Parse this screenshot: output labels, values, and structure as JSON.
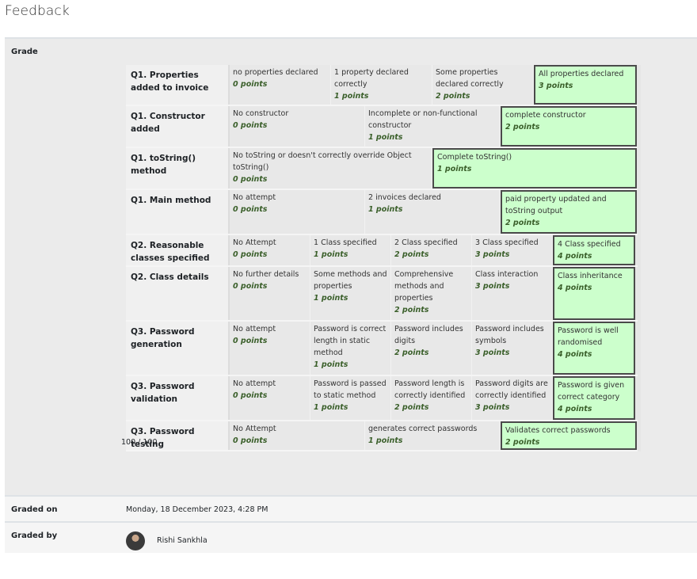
{
  "page": {
    "title": "Feedback"
  },
  "grade_label": "Grade",
  "rubric": [
    {
      "title": "Q1. Properties added to invoice",
      "levels": [
        {
          "desc": "no properties declared",
          "points": "0 points",
          "w": 128
        },
        {
          "desc": "1 property declared correctly",
          "points": "1 points",
          "w": 128
        },
        {
          "desc": "Some properties declared correctly",
          "points": "2 points",
          "w": 128
        },
        {
          "desc": "All properties declared",
          "points": "3 points",
          "w": 130,
          "selected": true
        }
      ],
      "h": 52
    },
    {
      "title": "Q1. Constructor added",
      "levels": [
        {
          "desc": "No constructor",
          "points": "0 points",
          "w": 171
        },
        {
          "desc": "Incomplete or non-functional constructor",
          "points": "1 points",
          "w": 171
        },
        {
          "desc": "complete constructor",
          "points": "2 points",
          "w": 172,
          "selected": true
        }
      ],
      "h": 53
    },
    {
      "title": "Q1. toString() method",
      "levels": [
        {
          "desc": "No toString or doesn't correctly override Object toString()",
          "points": "0 points",
          "w": 256
        },
        {
          "desc": "Complete toString()",
          "points": "1 points",
          "w": 258,
          "selected": true
        }
      ],
      "h": 53
    },
    {
      "title": "Q1. Main method",
      "levels": [
        {
          "desc": "No attempt",
          "points": "0 points",
          "w": 171
        },
        {
          "desc": "2 invoices declared",
          "points": "1 points",
          "w": 171
        },
        {
          "desc": "paid property updated and toString output",
          "points": "2 points",
          "w": 172,
          "selected": true
        }
      ],
      "h": 57
    },
    {
      "title": "Q2. Reasonable classes specified",
      "levels": [
        {
          "desc": "No Attempt",
          "points": "0 points",
          "w": 102
        },
        {
          "desc": "1 Class specified",
          "points": "1 points",
          "w": 102
        },
        {
          "desc": "2 Class specified",
          "points": "2 points",
          "w": 102
        },
        {
          "desc": "3 Class specified",
          "points": "3 points",
          "w": 102
        },
        {
          "desc": "4 Class specified",
          "points": "4 points",
          "w": 104,
          "selected": true
        }
      ],
      "h": 40
    },
    {
      "title": "Q2. Class details",
      "levels": [
        {
          "desc": "No further details",
          "points": "0 points",
          "w": 102
        },
        {
          "desc": "Some methods and properties",
          "points": "1 points",
          "w": 102
        },
        {
          "desc": "Comprehensive methods and properties",
          "points": "2 points",
          "w": 102
        },
        {
          "desc": "Class interaction",
          "points": "3 points",
          "w": 102
        },
        {
          "desc": "Class inheritance",
          "points": "4 points",
          "w": 104,
          "selected": true
        }
      ],
      "h": 69
    },
    {
      "title": "Q3. Password generation",
      "levels": [
        {
          "desc": "No attempt",
          "points": "0 points",
          "w": 102
        },
        {
          "desc": "Password is correct length in static method",
          "points": "1 points",
          "w": 102
        },
        {
          "desc": "Password includes digits",
          "points": "2 points",
          "w": 102
        },
        {
          "desc": "Password includes symbols",
          "points": "3 points",
          "w": 102
        },
        {
          "desc": "Password is well randomised",
          "points": "4 points",
          "w": 104,
          "selected": true
        }
      ],
      "h": 69
    },
    {
      "title": "Q3. Password validation",
      "levels": [
        {
          "desc": "No attempt",
          "points": "0 points",
          "w": 102
        },
        {
          "desc": "Password is passed to static method",
          "points": "1 points",
          "w": 102
        },
        {
          "desc": "Password length is correctly identified",
          "points": "2 points",
          "w": 102
        },
        {
          "desc": "Password digits are correctly identified",
          "points": "3 points",
          "w": 102
        },
        {
          "desc": "Password is given correct category",
          "points": "4 points",
          "w": 104,
          "selected": true
        }
      ],
      "h": 57
    },
    {
      "title": "Q3. Password testing",
      "levels": [
        {
          "desc": "No Attempt",
          "points": "0 points",
          "w": 171
        },
        {
          "desc": "generates correct passwords",
          "points": "1 points",
          "w": 171
        },
        {
          "desc": "Validates correct passwords",
          "points": "2 points",
          "w": 172,
          "selected": true
        }
      ],
      "h": 38
    }
  ],
  "score": "100 / 100",
  "graded_on": {
    "label": "Graded on",
    "value": "Monday, 18 December 2023, 4:28 PM"
  },
  "graded_by": {
    "label": "Graded by",
    "value": "Rishi Sankhla"
  }
}
